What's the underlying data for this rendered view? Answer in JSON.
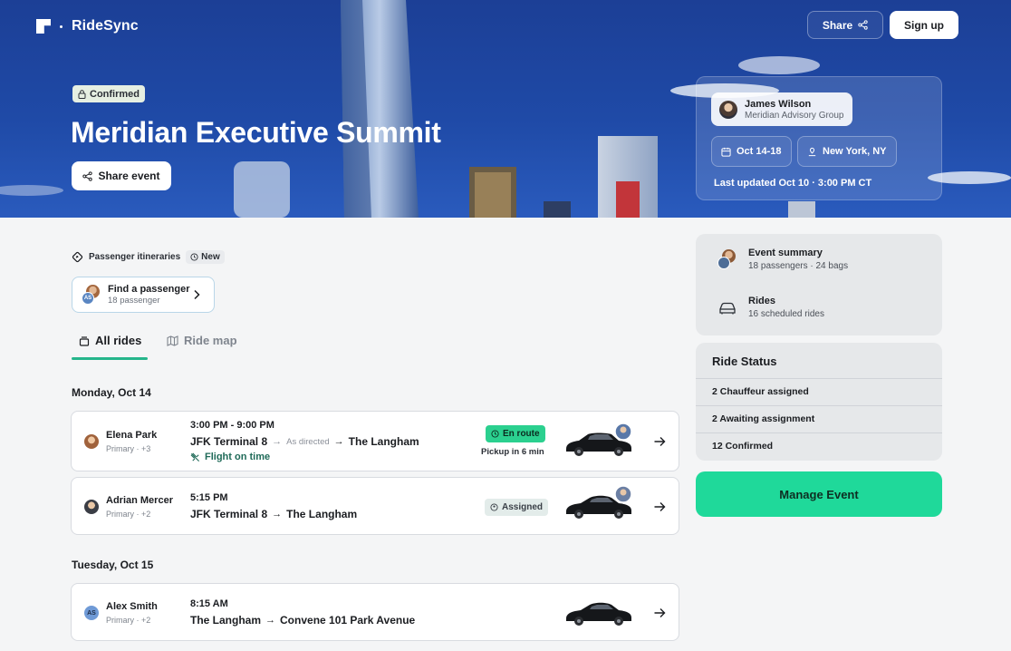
{
  "app": {
    "name": "RideSync"
  },
  "header": {
    "share_label": "Share",
    "signup_label": "Sign up"
  },
  "event": {
    "status": "Confirmed",
    "title": "Meridian Executive Summit",
    "share_event_label": "Share event"
  },
  "host": {
    "name": "James Wilson",
    "org": "Meridian Advisory Group"
  },
  "event_info": {
    "dates": "Oct 14-18",
    "location": "New York, NY",
    "updated": "Last updated Oct 10 · 3:00 PM CT"
  },
  "itineraries": {
    "label": "Passenger itineraries",
    "new_badge": "New",
    "find_label": "Find a passenger",
    "find_count": "18 passenger",
    "find_avatar_initials": "AS"
  },
  "tabs": [
    {
      "label": "All rides",
      "active": true
    },
    {
      "label": "Ride map",
      "active": false
    }
  ],
  "days": [
    {
      "label": "Monday, Oct 14",
      "rides": [
        {
          "name": "Elena Park",
          "sub": "Primary · +3",
          "time": "3:00 PM - 9:00 PM",
          "from": "JFK Terminal 8",
          "via": "As directed",
          "to": "The Langham",
          "flight": "Flight on time",
          "status": "En route",
          "pickup": "Pickup in 6 min"
        },
        {
          "name": "Adrian Mercer",
          "sub": "Primary · +2",
          "time": "5:15 PM",
          "from": "JFK Terminal 8",
          "to": "The Langham",
          "status": "Assigned"
        }
      ]
    },
    {
      "label": "Tuesday, Oct 15",
      "rides": [
        {
          "name": "Alex Smith",
          "initials": "AS",
          "sub": "Primary · +2",
          "time": "8:15 AM",
          "from": "The Langham",
          "to": "Convene 101 Park Avenue"
        }
      ]
    }
  ],
  "summary": {
    "event_title": "Event summary",
    "event_detail": "18 passengers · 24 bags",
    "rides_title": "Rides",
    "rides_detail": "16 scheduled rides"
  },
  "ride_status": {
    "title": "Ride Status",
    "rows": [
      "2 Chauffeur assigned",
      "2 Awaiting assignment",
      "12 Confirmed"
    ]
  },
  "manage_label": "Manage Event",
  "colors": {
    "brand_blue": "#1f4aa7",
    "accent_green": "#1fd99a",
    "tab_underline": "#25b58b"
  }
}
